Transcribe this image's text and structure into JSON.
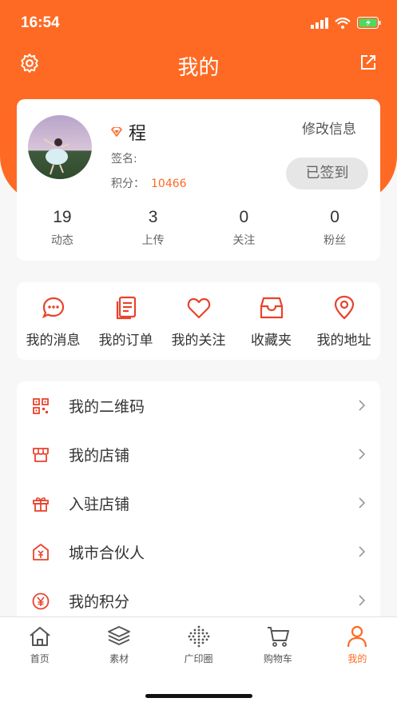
{
  "status_bar": {
    "time": "16:54"
  },
  "nav": {
    "title": "我的",
    "left_icon": "settings-icon",
    "right_icon": "share-icon"
  },
  "profile": {
    "name": "程",
    "signature_label": "签名:",
    "points_label": "积分：",
    "points_value": "10466",
    "edit_label": "修改信息",
    "signed_label": "已签到",
    "stats": [
      {
        "value": "19",
        "label": "动态"
      },
      {
        "value": "3",
        "label": "上传"
      },
      {
        "value": "0",
        "label": "关注"
      },
      {
        "value": "0",
        "label": "粉丝"
      }
    ]
  },
  "quick_actions": [
    {
      "label": "我的消息",
      "icon": "message-icon"
    },
    {
      "label": "我的订单",
      "icon": "order-icon"
    },
    {
      "label": "我的关注",
      "icon": "heart-icon"
    },
    {
      "label": "收藏夹",
      "icon": "inbox-icon"
    },
    {
      "label": "我的地址",
      "icon": "location-icon"
    }
  ],
  "menu": [
    {
      "label": "我的二维码",
      "icon": "qrcode-icon"
    },
    {
      "label": "我的店铺",
      "icon": "shop-icon"
    },
    {
      "label": "入驻店铺",
      "icon": "gift-icon"
    },
    {
      "label": "城市合伙人",
      "icon": "partner-icon"
    },
    {
      "label": "我的积分",
      "icon": "yuan-icon"
    }
  ],
  "tabs": [
    {
      "label": "首页",
      "icon": "home-icon"
    },
    {
      "label": "素材",
      "icon": "layers-icon"
    },
    {
      "label": "广印圈",
      "icon": "dots-icon"
    },
    {
      "label": "购物车",
      "icon": "cart-icon"
    },
    {
      "label": "我的",
      "icon": "person-icon",
      "active": true
    }
  ],
  "colors": {
    "accent": "#fe6a23",
    "background": "#f7f7f7"
  }
}
